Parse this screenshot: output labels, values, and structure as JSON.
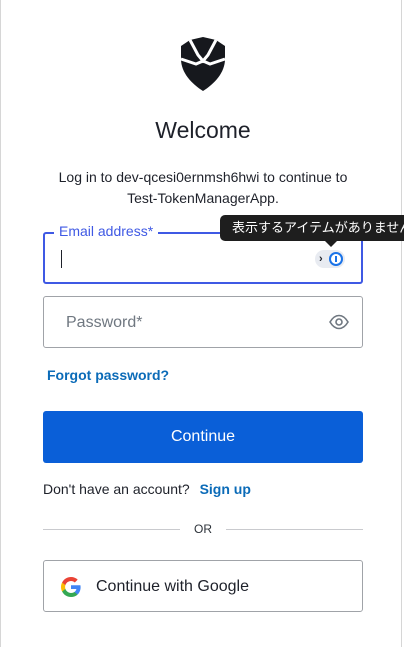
{
  "header": {
    "title": "Welcome",
    "subtitle_line1": "Log in to dev-qcesi0ernmsh6hwi to continue to",
    "subtitle_line2": "Test-TokenManagerApp."
  },
  "email_field": {
    "label": "Email address*",
    "value": ""
  },
  "tooltip": {
    "text": "表示するアイテムがありません"
  },
  "password_field": {
    "placeholder": "Password*"
  },
  "links": {
    "forgot_password": "Forgot password?",
    "no_account": "Don't have an account?",
    "sign_up": "Sign up"
  },
  "buttons": {
    "continue": "Continue",
    "google": "Continue with Google"
  },
  "divider": {
    "label": "OR"
  },
  "colors": {
    "primary": "#0a5fd8",
    "link": "#0b6bb8",
    "focus": "#3f59e4"
  },
  "icons": {
    "logo": "shield-logo-icon",
    "password_manager": "password-manager-icon",
    "show_password": "eye-icon",
    "google": "google-icon"
  }
}
